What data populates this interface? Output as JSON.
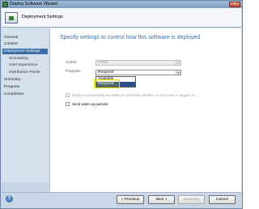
{
  "window": {
    "title": "Deploy Software Wizard",
    "close_glyph": "✕"
  },
  "header": {
    "title": "Deployment Settings"
  },
  "sidebar": {
    "items": [
      {
        "label": "General"
      },
      {
        "label": "Content"
      },
      {
        "label": "Deployment Settings"
      },
      {
        "label": "Scheduling"
      },
      {
        "label": "User Experience"
      },
      {
        "label": "Distribution Points"
      },
      {
        "label": "Summary"
      },
      {
        "label": "Progress"
      },
      {
        "label": "Completion"
      }
    ],
    "active_index": 2
  },
  "main": {
    "heading": "Specify settings to control how this software is deployed",
    "action": {
      "label": "Action:",
      "value": "Install"
    },
    "purpose": {
      "label": "Purpose:",
      "value": "Required",
      "options": [
        "Available",
        "Required"
      ],
      "highlighted_option": "Required"
    },
    "deploy_automatically": {
      "label": "Deploy automatically according to schedule whether or not a user is logged on",
      "checked": false,
      "enabled": false
    },
    "wake_up": {
      "label": "Send wake-up packets",
      "checked": false,
      "enabled": true
    }
  },
  "footer": {
    "help_glyph": "?",
    "previous_label": "< Previous",
    "next_label": "Next >",
    "summary_label": "Summary",
    "cancel_label": "Cancel"
  },
  "colors": {
    "accent": "#3e6ea8",
    "selected": "#2e4f8a",
    "highlight": "#e6e600"
  }
}
